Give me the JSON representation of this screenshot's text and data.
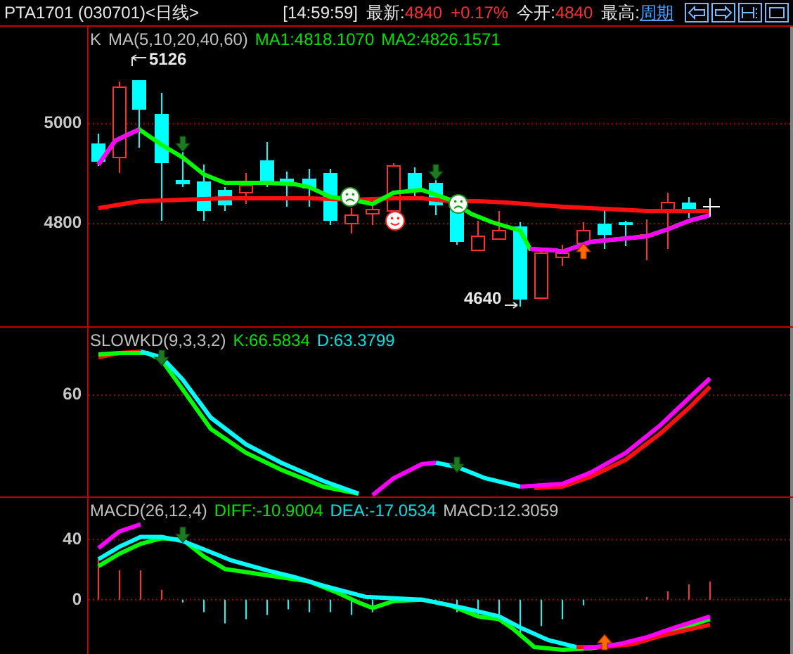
{
  "header": {
    "symbol": "PTA1701 (030701)<日线>",
    "time": "[14:59:59]",
    "quotes": [
      {
        "label": "最新:",
        "values": [
          "4840",
          "+0.17%"
        ]
      },
      {
        "label": "今开:",
        "values": [
          "4840"
        ]
      }
    ],
    "high": {
      "label": "最高:",
      "link": "周期"
    }
  },
  "panels": [
    {
      "kind": "price",
      "legend": [
        {
          "text": "K",
          "color": "#c0c0c0"
        },
        {
          "text": "MA(5,10,20,40,60)",
          "color": "#c0c0c0"
        },
        {
          "text": "MA1:4818.1070",
          "color": "#00e000"
        },
        {
          "text": "MA2:4826.1571",
          "color": "#00e000"
        }
      ],
      "y_labels": [
        "5000",
        "4800"
      ],
      "annotations": [
        "5126",
        "4640"
      ]
    },
    {
      "kind": "kd",
      "legend": [
        {
          "text": "SLOWKD(9,3,3,2)",
          "color": "#c0c0c0"
        },
        {
          "text": "K:66.5834",
          "color": "#00e000"
        },
        {
          "text": "D:63.3799",
          "color": "#00e0e0"
        }
      ],
      "y_labels": [
        "60"
      ]
    },
    {
      "kind": "macd",
      "legend": [
        {
          "text": "MACD(26,12,4)",
          "color": "#c0c0c0"
        },
        {
          "text": "DIFF:-10.9004",
          "color": "#00e000"
        },
        {
          "text": "DEA:-17.0534",
          "color": "#00e0e0"
        },
        {
          "text": "MACD:12.3059",
          "color": "#c0c0c0"
        }
      ],
      "y_labels": [
        "40",
        "0"
      ]
    }
  ]
}
